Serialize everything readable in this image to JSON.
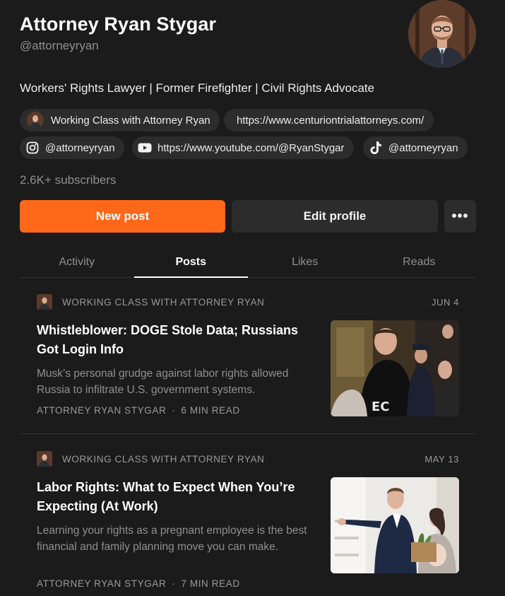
{
  "profile": {
    "name": "Attorney Ryan Stygar",
    "handle": "@attorneyryan",
    "bio": "Workers' Rights Lawyer | Former Firefighter | Civil Rights Advocate",
    "subscribers": "2.6K+ subscribers"
  },
  "links": [
    {
      "label": "Working Class with Attorney Ryan",
      "icon": "publication-avatar"
    },
    {
      "label": "https://www.centuriontrialattorneys.com/",
      "icon": ""
    },
    {
      "label": "@attorneyryan",
      "icon": "instagram-icon"
    },
    {
      "label": "https://www.youtube.com/@RyanStygar",
      "icon": "youtube-icon"
    },
    {
      "label": "@attorneyryan",
      "icon": "tiktok-icon"
    }
  ],
  "actions": {
    "new_post": "New post",
    "edit_profile": "Edit profile",
    "more": "•••"
  },
  "tabs": [
    {
      "label": "Activity",
      "active": false
    },
    {
      "label": "Posts",
      "active": true
    },
    {
      "label": "Likes",
      "active": false
    },
    {
      "label": "Reads",
      "active": false
    }
  ],
  "posts": [
    {
      "publication": "WORKING CLASS WITH ATTORNEY RYAN",
      "date": "JUN 4",
      "title": "Whistleblower: DOGE Stole Data; Russians Got Login Info",
      "subtitle": "Musk’s personal grudge against labor rights allowed Russia to infiltrate U.S. government systems.",
      "author": "ATTORNEY RYAN STYGAR",
      "read_time": "6 MIN READ"
    },
    {
      "publication": "WORKING CLASS WITH ATTORNEY RYAN",
      "date": "MAY 13",
      "title": "Labor Rights: What to Expect When You’re Expecting (At Work)",
      "subtitle": "Learning your rights as a pregnant employee is the best financial and family planning move you can make.",
      "author": "ATTORNEY RYAN STYGAR",
      "read_time": "7 MIN READ"
    }
  ],
  "colors": {
    "background": "#1b1b1b",
    "accent": "#ff6719",
    "chip": "#2c2c2c"
  }
}
